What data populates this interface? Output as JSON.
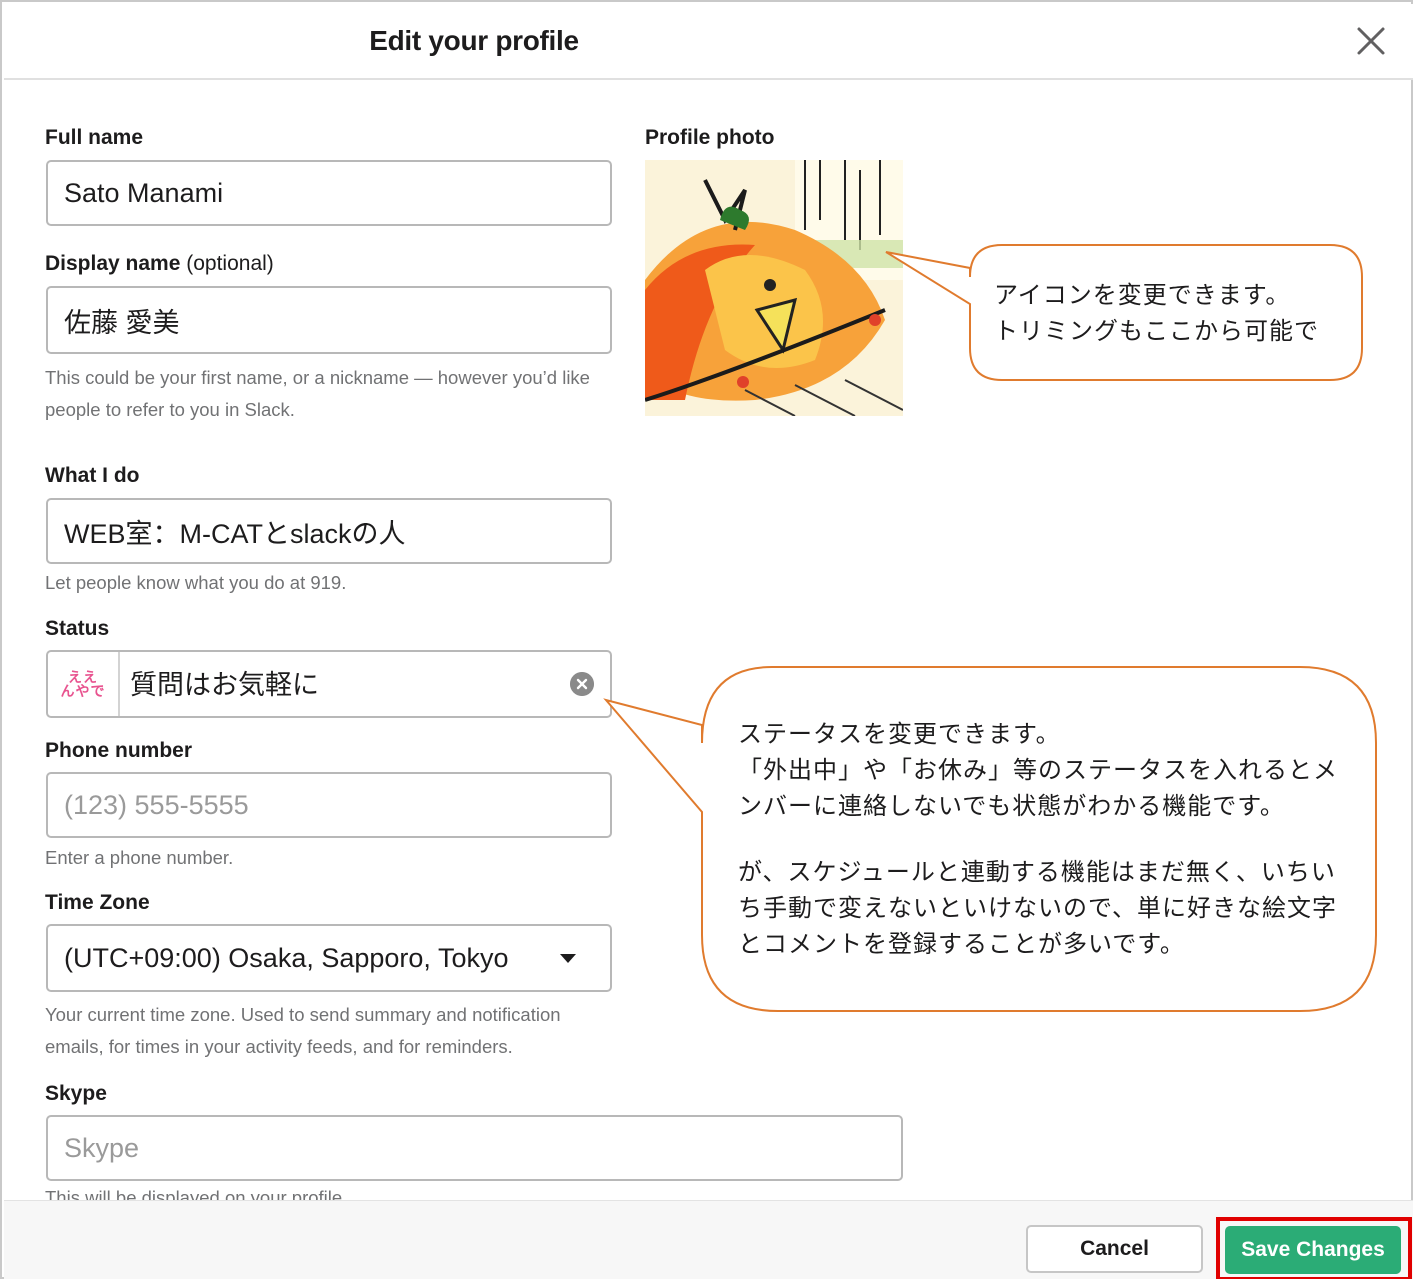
{
  "header": {
    "title": "Edit your profile"
  },
  "form": {
    "full_name": {
      "label": "Full name",
      "value": "Sato Manami"
    },
    "display_name": {
      "label": "Display name",
      "label_optional": "(optional)",
      "value": "佐藤 愛美",
      "hint_line1": "This could be your first name, or a nickname — however you’d like",
      "hint_line2": "people to refer to you in Slack."
    },
    "what_i_do": {
      "label": "What I do",
      "value": "WEB室：M-CATとslackの人",
      "hint": "Let people know what you do at 919."
    },
    "status": {
      "label": "Status",
      "emoji_line1": "ええ",
      "emoji_line2": "んやで",
      "value": "質問はお気軽に"
    },
    "phone": {
      "label": "Phone number",
      "placeholder": "(123) 555-5555",
      "hint": "Enter a phone number."
    },
    "time_zone": {
      "label": "Time Zone",
      "value": "(UTC+09:00) Osaka, Sapporo, Tokyo",
      "hint_line1": "Your current time zone. Used to send summary and notification",
      "hint_line2": "emails, for times in your activity feeds, and for reminders."
    },
    "skype": {
      "label": "Skype",
      "placeholder": "Skype",
      "hint": "This will be displayed on your profile."
    }
  },
  "profile_photo": {
    "label": "Profile photo"
  },
  "callouts": {
    "photo_line1": "アイコンを変更できます。",
    "photo_line2": "トリミングもここから可能で",
    "status_line1": "ステータスを変更できます。",
    "status_line2": "「外出中」や「お休み」等のステータスを入れるとメ",
    "status_line3": "ンバーに連絡しないでも状態がわかる機能です。",
    "status_line4": "が、スケジュールと連動する機能はまだ無く、いちい",
    "status_line5": "ち手動で変えないといけないので、単に好きな絵文字",
    "status_line6": "とコメントを登録することが多いです。"
  },
  "footer": {
    "cancel_label": "Cancel",
    "save_label": "Save Changes"
  },
  "colors": {
    "save_button": "#2bac76",
    "highlight": "#e00000",
    "callout_border": "#e07b2e",
    "emoji_pink": "#e8538f"
  }
}
